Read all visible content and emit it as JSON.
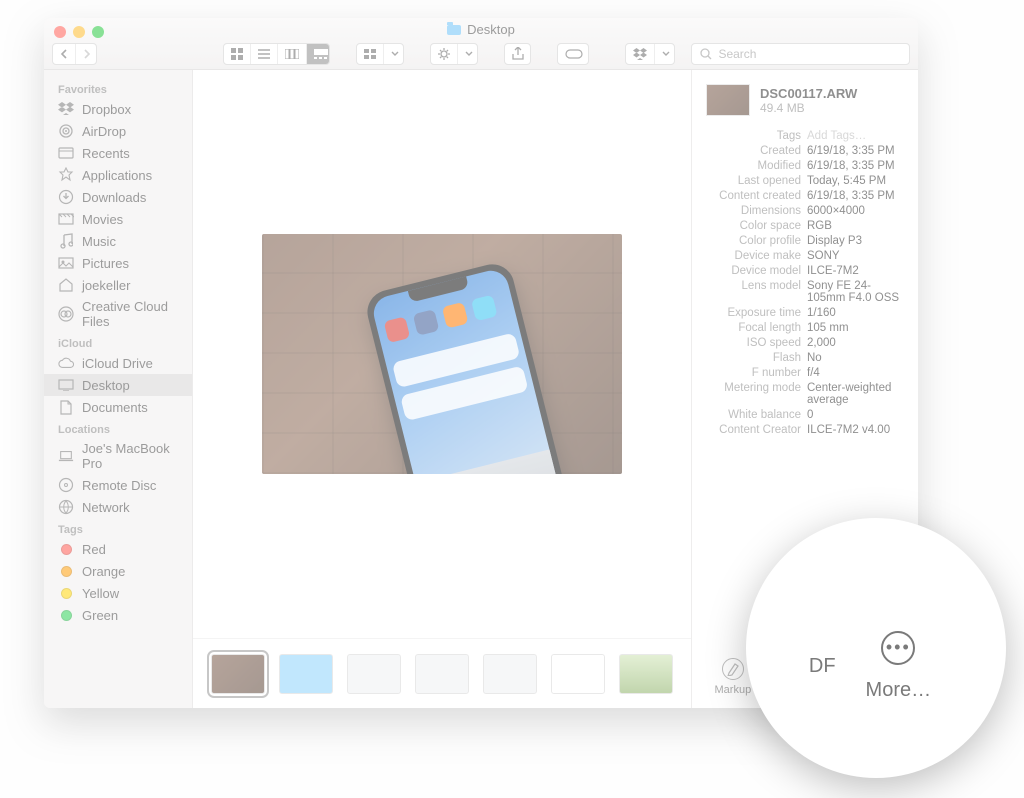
{
  "window": {
    "title": "Desktop"
  },
  "toolbar": {
    "search_placeholder": "Search"
  },
  "sidebar": {
    "sections": [
      {
        "title": "Favorites",
        "items": [
          {
            "label": "Dropbox",
            "icon": "dropbox-icon"
          },
          {
            "label": "AirDrop",
            "icon": "airdrop-icon"
          },
          {
            "label": "Recents",
            "icon": "recents-icon"
          },
          {
            "label": "Applications",
            "icon": "applications-icon"
          },
          {
            "label": "Downloads",
            "icon": "downloads-icon"
          },
          {
            "label": "Movies",
            "icon": "movies-icon"
          },
          {
            "label": "Music",
            "icon": "music-icon"
          },
          {
            "label": "Pictures",
            "icon": "pictures-icon"
          },
          {
            "label": "joekeller",
            "icon": "home-icon"
          },
          {
            "label": "Creative Cloud Files",
            "icon": "cc-icon"
          }
        ]
      },
      {
        "title": "iCloud",
        "items": [
          {
            "label": "iCloud Drive",
            "icon": "icloud-icon"
          },
          {
            "label": "Desktop",
            "icon": "desktop-icon",
            "selected": true
          },
          {
            "label": "Documents",
            "icon": "documents-icon"
          }
        ]
      },
      {
        "title": "Locations",
        "items": [
          {
            "label": "Joe's MacBook Pro",
            "icon": "laptop-icon"
          },
          {
            "label": "Remote Disc",
            "icon": "disc-icon"
          },
          {
            "label": "Network",
            "icon": "network-icon"
          }
        ]
      },
      {
        "title": "Tags",
        "items": [
          {
            "label": "Red",
            "color": "#ff5b53"
          },
          {
            "label": "Orange",
            "color": "#ff9f0a"
          },
          {
            "label": "Yellow",
            "color": "#ffd60a"
          },
          {
            "label": "Green",
            "color": "#30d158"
          }
        ]
      }
    ]
  },
  "file": {
    "name": "DSC00117.ARW",
    "size": "49.4 MB",
    "tags_placeholder": "Add Tags…",
    "meta": [
      {
        "k": "Tags",
        "v": "Add Tags…",
        "placeholder": true
      },
      {
        "k": "Created",
        "v": "6/19/18, 3:35 PM"
      },
      {
        "k": "Modified",
        "v": "6/19/18, 3:35 PM"
      },
      {
        "k": "Last opened",
        "v": "Today, 5:45 PM"
      },
      {
        "k": "Content created",
        "v": "6/19/18, 3:35 PM"
      },
      {
        "k": "Dimensions",
        "v": "6000×4000"
      },
      {
        "k": "Color space",
        "v": "RGB"
      },
      {
        "k": "Color profile",
        "v": "Display P3"
      },
      {
        "k": "Device make",
        "v": "SONY"
      },
      {
        "k": "Device model",
        "v": "ILCE-7M2"
      },
      {
        "k": "Lens model",
        "v": "Sony FE 24-105mm F4.0 OSS"
      },
      {
        "k": "Exposure time",
        "v": "1/160"
      },
      {
        "k": "Focal length",
        "v": "105 mm"
      },
      {
        "k": "ISO speed",
        "v": "2,000"
      },
      {
        "k": "Flash",
        "v": "No"
      },
      {
        "k": "F number",
        "v": "f/4"
      },
      {
        "k": "Metering mode",
        "v": "Center-weighted average"
      },
      {
        "k": "White balance",
        "v": "0"
      },
      {
        "k": "Content Creator",
        "v": "ILCE-7M2 v4.00"
      }
    ]
  },
  "quick_actions": [
    {
      "label": "Markup",
      "icon": "markup-icon"
    },
    {
      "label": "Create PDF",
      "icon": "pdf-icon"
    },
    {
      "label": "More…",
      "icon": "more-icon"
    }
  ],
  "zoom": {
    "left_label": "DF",
    "right_label": "More…"
  }
}
